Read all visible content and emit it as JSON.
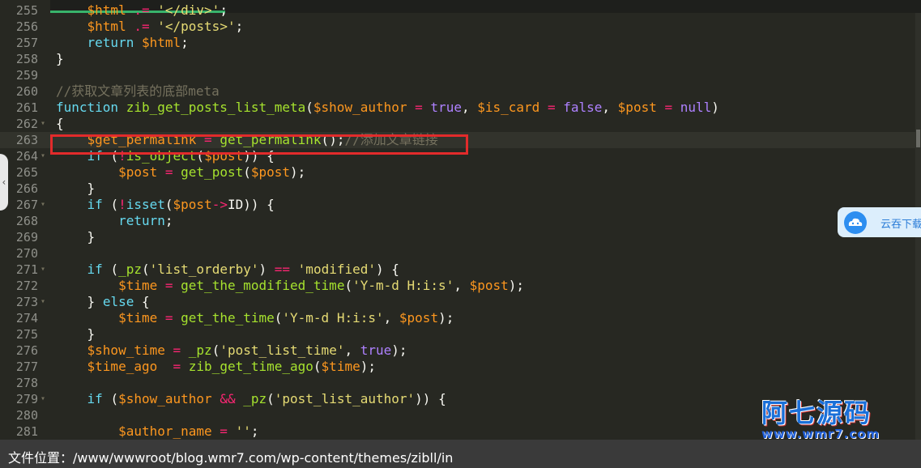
{
  "editor": {
    "lines": [
      {
        "num": "255",
        "fold": "",
        "code": "    $html .= '</div>';"
      },
      {
        "num": "256",
        "fold": "",
        "code": "    $html .= '</posts>';"
      },
      {
        "num": "257",
        "fold": "",
        "code": "    return $html;"
      },
      {
        "num": "258",
        "fold": "",
        "code": "}"
      },
      {
        "num": "259",
        "fold": "",
        "code": ""
      },
      {
        "num": "260",
        "fold": "",
        "code": "//获取文章列表的底部meta"
      },
      {
        "num": "261",
        "fold": "",
        "code": "function zib_get_posts_list_meta($show_author = true, $is_card = false, $post = null)"
      },
      {
        "num": "262",
        "fold": "▾",
        "code": "{"
      },
      {
        "num": "263",
        "fold": "",
        "code": "    $get_permalink = get_permalink();//添加文章链接"
      },
      {
        "num": "264",
        "fold": "▾",
        "code": "    if (!is_object($post)) {"
      },
      {
        "num": "265",
        "fold": "",
        "code": "        $post = get_post($post);"
      },
      {
        "num": "266",
        "fold": "",
        "code": "    }"
      },
      {
        "num": "267",
        "fold": "▾",
        "code": "    if (!isset($post->ID)) {"
      },
      {
        "num": "268",
        "fold": "",
        "code": "        return;"
      },
      {
        "num": "269",
        "fold": "",
        "code": "    }"
      },
      {
        "num": "270",
        "fold": "",
        "code": ""
      },
      {
        "num": "271",
        "fold": "▾",
        "code": "    if (_pz('list_orderby') == 'modified') {"
      },
      {
        "num": "272",
        "fold": "",
        "code": "        $time = get_the_modified_time('Y-m-d H:i:s', $post);"
      },
      {
        "num": "273",
        "fold": "▾",
        "code": "    } else {"
      },
      {
        "num": "274",
        "fold": "",
        "code": "        $time = get_the_time('Y-m-d H:i:s', $post);"
      },
      {
        "num": "275",
        "fold": "",
        "code": "    }"
      },
      {
        "num": "276",
        "fold": "",
        "code": "    $show_time = _pz('post_list_time', true);"
      },
      {
        "num": "277",
        "fold": "",
        "code": "    $time_ago  = zib_get_time_ago($time);"
      },
      {
        "num": "278",
        "fold": "",
        "code": ""
      },
      {
        "num": "279",
        "fold": "▾",
        "code": "    if ($show_author && _pz('post_list_author')) {"
      },
      {
        "num": "280",
        "fold": "",
        "code": ""
      },
      {
        "num": "281",
        "fold": "",
        "code": "        $author_name = '';"
      }
    ]
  },
  "cloud_widget": {
    "label": "云吞下载"
  },
  "status_bar": {
    "path": "文件位置：/www/wwwroot/blog.wmr7.com/wp-content/themes/zibll/in"
  },
  "watermark": {
    "title": "阿七源码",
    "url": "www.wmr7.com"
  },
  "colors": {
    "background": "#272822",
    "keyword": "#f92672",
    "variable": "#fd971f",
    "function": "#66d9ef",
    "string": "#e6db74",
    "constant": "#ae81ff",
    "comment": "#75715e",
    "highlight_box": "#e22b2b"
  }
}
